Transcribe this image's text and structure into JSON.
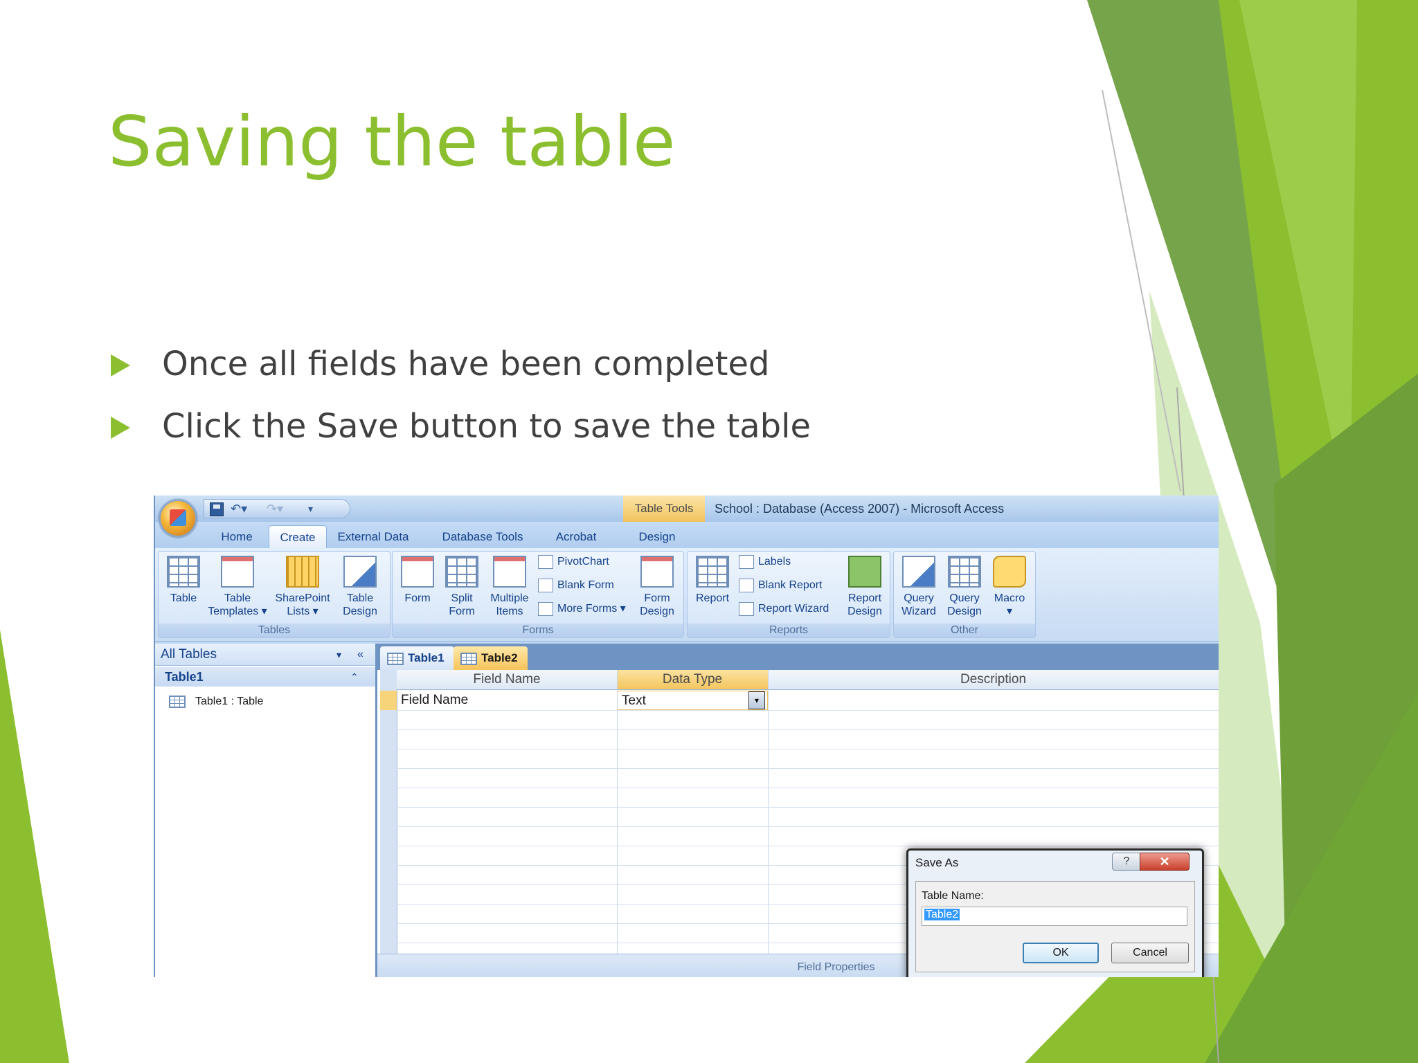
{
  "slide": {
    "title": "Saving the table",
    "bullets": [
      "Once all fields have been completed",
      "Click the Save button to save the table"
    ],
    "accent_color": "#8cbf2f"
  },
  "access": {
    "window_title": "School : Database (Access 2007) - Microsoft Access",
    "contextual_tab": "Table Tools",
    "tabs": [
      "Home",
      "Create",
      "External Data",
      "Database Tools",
      "Acrobat",
      "Design"
    ],
    "active_tab": "Create",
    "ribbon": {
      "tables": {
        "label": "Tables",
        "table": "Table",
        "table_templates": [
          "Table",
          "Templates ▾"
        ],
        "sharepoint_lists": [
          "SharePoint",
          "Lists ▾"
        ],
        "table_design": [
          "Table",
          "Design"
        ]
      },
      "forms": {
        "label": "Forms",
        "form": "Form",
        "split_form": [
          "Split",
          "Form"
        ],
        "multiple_items": [
          "Multiple",
          "Items"
        ],
        "pivotchart": "PivotChart",
        "blank_form": "Blank Form",
        "more_forms": "More Forms ▾",
        "form_design": [
          "Form",
          "Design"
        ]
      },
      "reports": {
        "label": "Reports",
        "report": "Report",
        "labels": "Labels",
        "blank_report": "Blank Report",
        "report_wizard": "Report Wizard",
        "report_design": [
          "Report",
          "Design"
        ]
      },
      "other": {
        "label": "Other",
        "query_wizard": [
          "Query",
          "Wizard"
        ],
        "query_design": [
          "Query",
          "Design"
        ],
        "macro": [
          "Macro",
          "▾"
        ]
      }
    },
    "nav": {
      "header": "All Tables",
      "group": "Table1",
      "item": "Table1 : Table"
    },
    "doc_tabs": [
      "Table1",
      "Table2"
    ],
    "grid": {
      "headers": [
        "Field Name",
        "Data Type",
        "Description"
      ],
      "row": {
        "field_name": "Field Name",
        "data_type": "Text"
      },
      "field_properties": "Field Properties"
    },
    "dialog": {
      "title": "Save As",
      "label": "Table Name:",
      "value": "Table2",
      "ok": "OK",
      "cancel": "Cancel",
      "help": "?",
      "close": "✕"
    }
  }
}
